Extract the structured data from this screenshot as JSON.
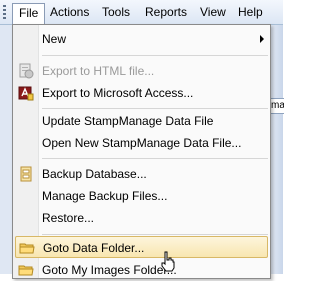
{
  "menubar": {
    "items": [
      {
        "label": "File"
      },
      {
        "label": "Actions"
      },
      {
        "label": "Tools"
      },
      {
        "label": "Reports"
      },
      {
        "label": "View"
      },
      {
        "label": "Help"
      }
    ]
  },
  "background": {
    "partial_text": "ma"
  },
  "file_menu": {
    "items": [
      {
        "label": "New",
        "icon": "none",
        "enabled": true,
        "submenu": true
      },
      {
        "label": "Export to HTML file...",
        "icon": "html-export-icon",
        "enabled": false
      },
      {
        "label": "Export to Microsoft Access...",
        "icon": "access-export-icon",
        "enabled": true
      },
      {
        "label": "Update StampManage Data File",
        "enabled": true
      },
      {
        "label": "Open New StampManage Data File...",
        "enabled": true
      },
      {
        "label": "Backup Database...",
        "icon": "backup-icon",
        "enabled": true
      },
      {
        "label": "Manage Backup Files...",
        "enabled": true
      },
      {
        "label": "Restore...",
        "enabled": true
      },
      {
        "label": "Goto Data Folder...",
        "icon": "folder-icon",
        "enabled": true,
        "highlighted": true
      },
      {
        "label": "Goto My Images Folder...",
        "icon": "folder-icon",
        "enabled": true
      }
    ]
  },
  "colors": {
    "highlight": "#f8e6b0",
    "menubar": "#dce6f4",
    "disabled_text": "#9a9a9a"
  }
}
